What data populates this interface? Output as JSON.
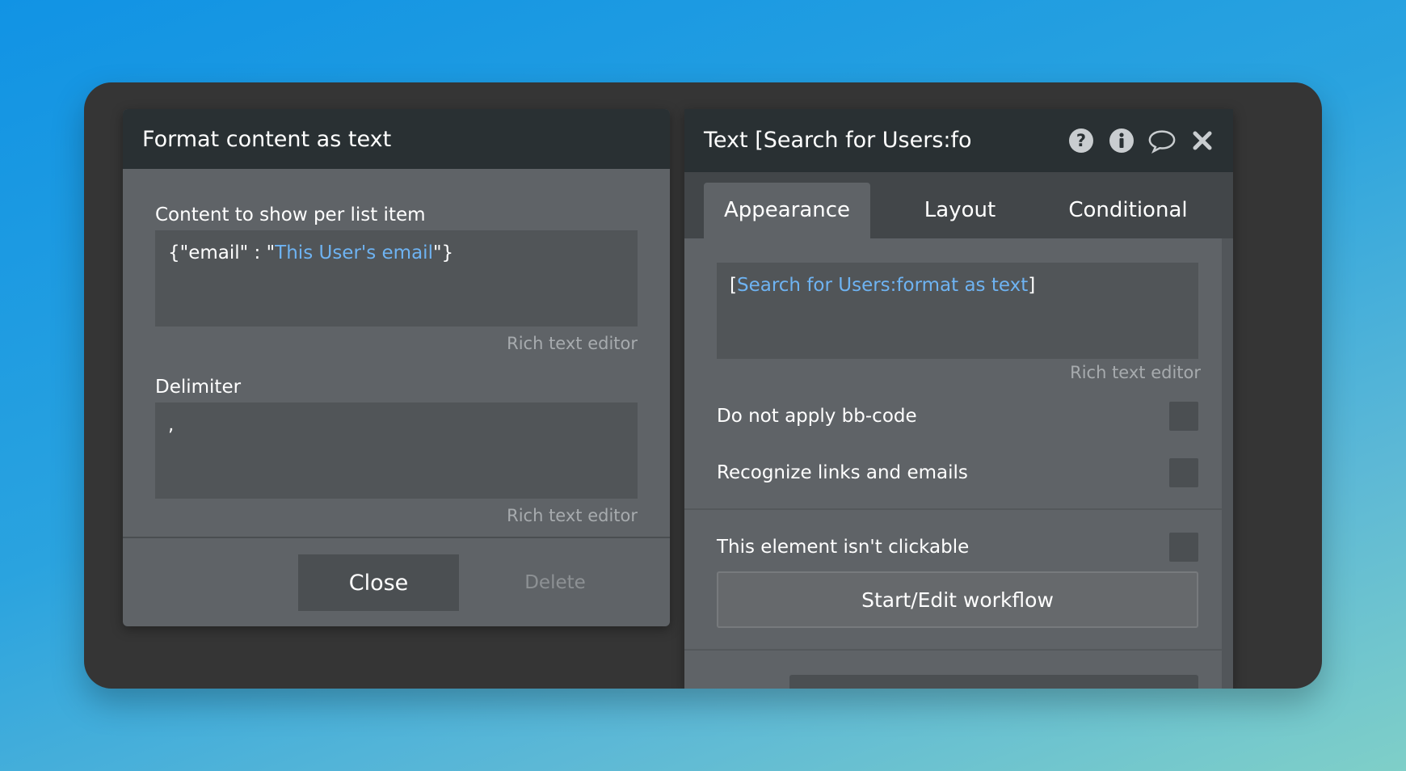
{
  "left_dialog": {
    "title": "Format content as text",
    "content_field": {
      "label": "Content to show per list item",
      "prefix": "{\"email\" : \"",
      "dynamic": "This User's email",
      "suffix": "\"}",
      "rich_text_link": "Rich text editor"
    },
    "delimiter_field": {
      "label": "Delimiter",
      "value": ",",
      "rich_text_link": "Rich text editor"
    },
    "close_label": "Close",
    "delete_label": "Delete"
  },
  "right_panel": {
    "title": "Text [Search for Users:fo",
    "icons": [
      "help-icon",
      "info-icon",
      "comment-icon",
      "close-icon"
    ],
    "tabs": [
      {
        "label": "Appearance",
        "active": true
      },
      {
        "label": "Layout",
        "active": false
      },
      {
        "label": "Conditional",
        "active": false
      }
    ],
    "text_field": {
      "open_bracket": "[",
      "dynamic": "Search for Users:format as text",
      "close_bracket": "]",
      "rich_text_link": "Rich text editor"
    },
    "options": [
      {
        "label": "Do not apply bb-code",
        "checked": false
      },
      {
        "label": "Recognize links and emails",
        "checked": false
      },
      {
        "label": "This element isn't clickable",
        "checked": false
      }
    ],
    "workflow_button": "Start/Edit workflow"
  },
  "colors": {
    "dynamic_text": "#6eb3f2",
    "panel_bg": "#5f6367",
    "header_bg": "#293033"
  }
}
